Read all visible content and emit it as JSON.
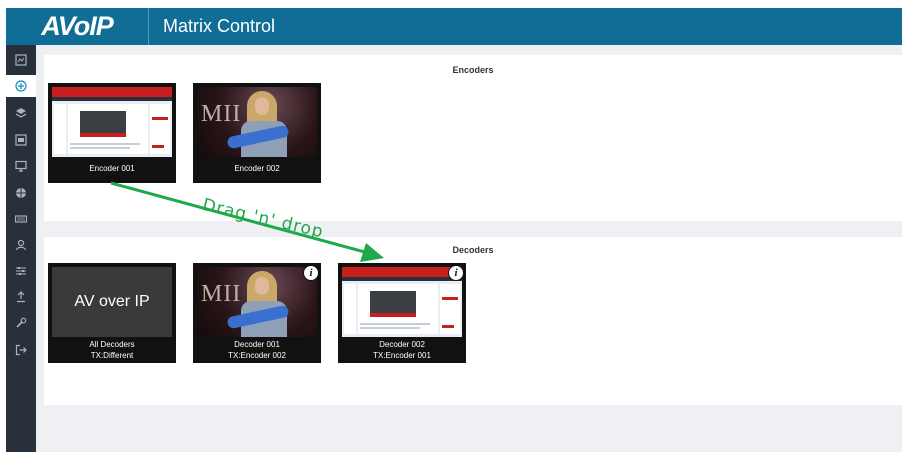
{
  "header": {
    "brand": "AVoIP",
    "title": "Matrix Control"
  },
  "sidebar": {
    "items": [
      {
        "icon": "dashboard-icon",
        "active": false
      },
      {
        "icon": "matrix-target-icon",
        "active": true
      },
      {
        "icon": "layers-icon",
        "active": false
      },
      {
        "icon": "encoder-icon",
        "active": false
      },
      {
        "icon": "monitor-icon",
        "active": false
      },
      {
        "icon": "network-icon",
        "active": false
      },
      {
        "icon": "keyboard-icon",
        "active": false
      },
      {
        "icon": "user-icon",
        "active": false
      },
      {
        "icon": "sliders-icon",
        "active": false
      },
      {
        "icon": "upload-icon",
        "active": false
      },
      {
        "icon": "wrench-icon",
        "active": false
      },
      {
        "icon": "logout-icon",
        "active": false
      }
    ]
  },
  "encoders": {
    "title": "Encoders",
    "items": [
      {
        "label": "Encoder 001",
        "thumb": "product-webpage"
      },
      {
        "label": "Encoder 002",
        "thumb": "guitarist"
      }
    ]
  },
  "decoders": {
    "title": "Decoders",
    "items": [
      {
        "name": "All Decoders",
        "tx": "TX:Different",
        "preview_text": "AV over IP"
      },
      {
        "name": "Decoder 001",
        "tx": "TX:Encoder 002",
        "thumb": "guitarist",
        "info": "i"
      },
      {
        "name": "Decoder 002",
        "tx": "TX:Encoder 001",
        "thumb": "product-webpage",
        "info": "i"
      }
    ]
  },
  "annotation": {
    "text": "Drag 'n' drop",
    "color": "#1fa94a"
  },
  "colors": {
    "header": "#0f6d96",
    "sidebar": "#28313b",
    "active_icon": "#0f8fbd"
  }
}
